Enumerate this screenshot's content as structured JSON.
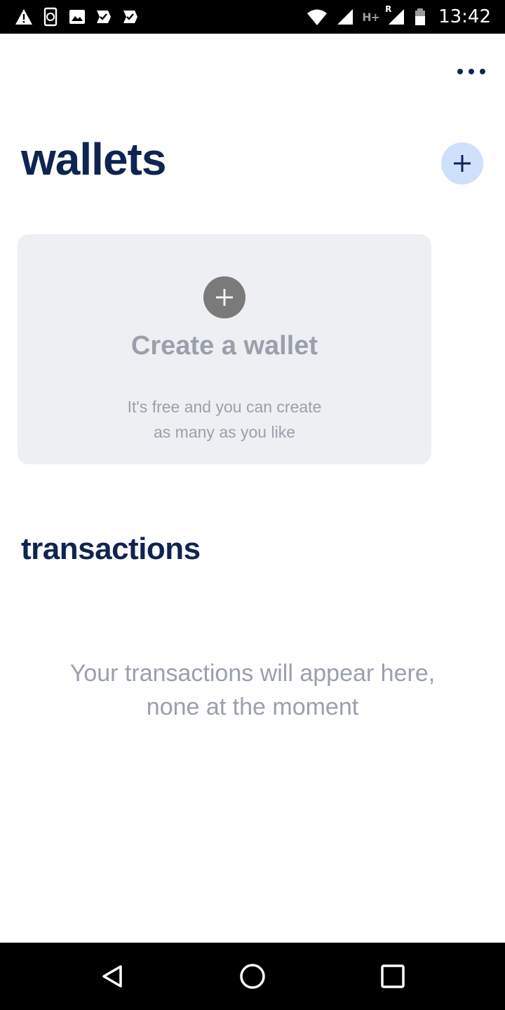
{
  "status_bar": {
    "left_icons": [
      "warning-icon",
      "phone-sync-icon",
      "image-icon",
      "checkmark-badge-icon",
      "checkmark-badge-icon"
    ],
    "right_icons": [
      "wifi-icon",
      "signal-icon",
      "signal-roaming-icon",
      "battery-icon"
    ],
    "network_label": "H+",
    "roaming_label": "R",
    "time": "13:42"
  },
  "header": {
    "more_icon": "more-horizontal-icon"
  },
  "wallets": {
    "title": "wallets",
    "add_icon": "plus-icon",
    "create_card": {
      "icon": "plus-icon",
      "title": "Create a wallet",
      "subtitle_line1": "It's free and you can create",
      "subtitle_line2": "as many as you like"
    }
  },
  "transactions": {
    "title": "transactions",
    "empty_line1": "Your transactions will appear here,",
    "empty_line2": "none at the moment"
  },
  "nav_bar": {
    "back_icon": "back-triangle-icon",
    "home_icon": "home-circle-icon",
    "recents_icon": "recents-square-icon"
  },
  "colors": {
    "primary_text": "#0f2451",
    "muted_text": "#9aa0ab",
    "card_bg": "#eeeff3",
    "fab_bg": "#cfe0fb",
    "card_icon_bg": "#7a7a7a"
  }
}
